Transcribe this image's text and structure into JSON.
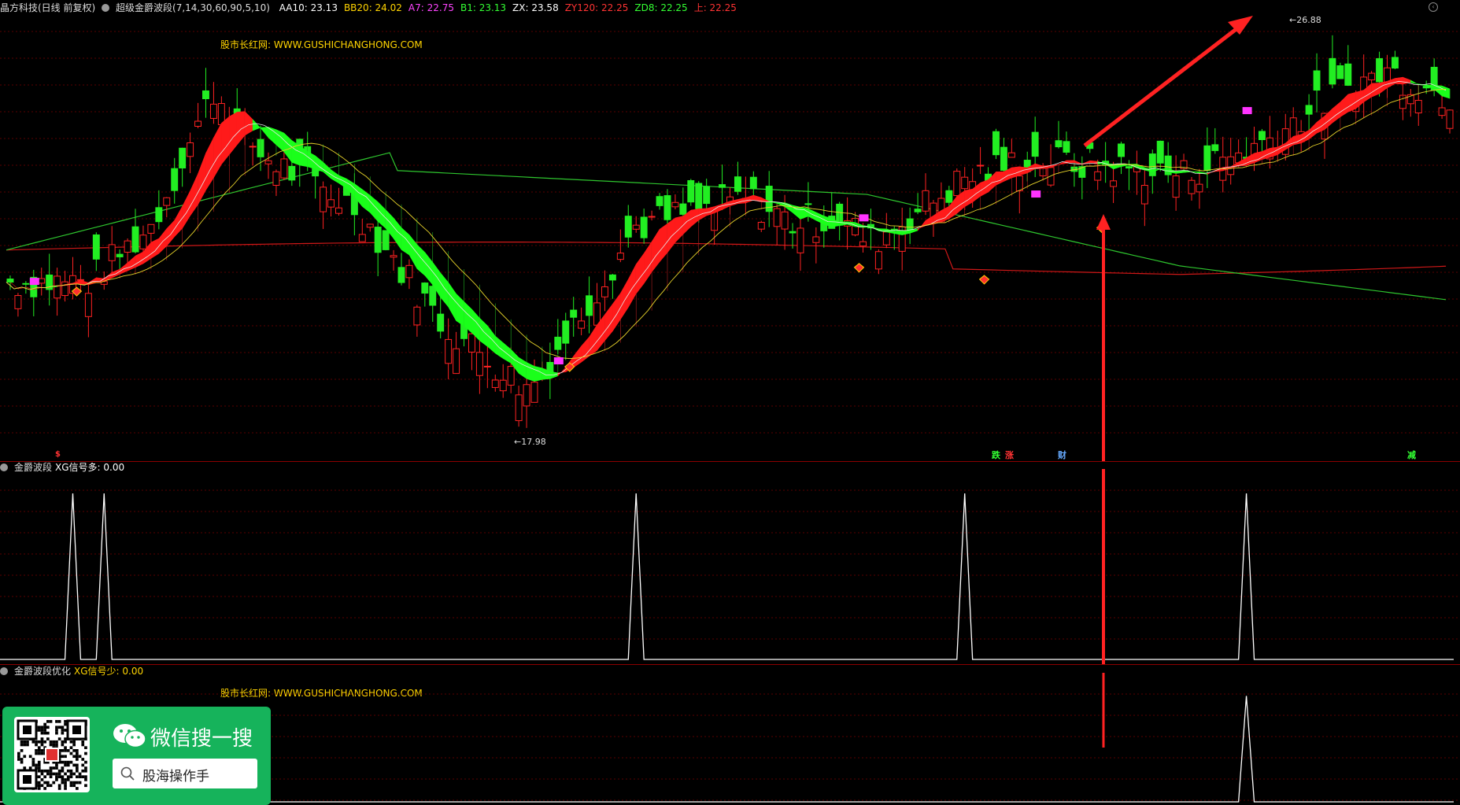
{
  "main_header": {
    "stock": "晶方科技(日线 前复权)",
    "indicator": "超级金爵波段(7,14,30,60,90,5,10)",
    "values": [
      {
        "text": "AA10: 23.13",
        "color": "#ffffff"
      },
      {
        "text": "BB20: 24.02",
        "color": "#ffd400"
      },
      {
        "text": "A7: 22.75",
        "color": "#ff44ff"
      },
      {
        "text": "B1: 23.13",
        "color": "#33ff33"
      },
      {
        "text": "ZX: 23.58",
        "color": "#ffffff"
      },
      {
        "text": "ZY120: 22.25",
        "color": "#ff3333"
      },
      {
        "text": "ZD8: 22.25",
        "color": "#33ff33"
      },
      {
        "text": "上: 22.25",
        "color": "#ff3333"
      }
    ]
  },
  "site_text": "股市长红网: WWW.GUSHICHANGHONG.COM",
  "price_labels": {
    "high": "26.88",
    "low": "17.98"
  },
  "event_tags": [
    {
      "text": "跌",
      "color": "#33ff33"
    },
    {
      "text": "涨",
      "color": "#ff3333"
    },
    {
      "text": "财",
      "color": "#66aaff"
    },
    {
      "text": "减",
      "color": "#33ff33"
    },
    {
      "text": "$",
      "color": "#ff3333"
    }
  ],
  "sub1_header": {
    "name": "金爵波段",
    "label": "XG信号多: 0.00"
  },
  "sub2_header": {
    "name": "金爵波段优化",
    "label": "XG信号少: 0.00"
  },
  "promo": {
    "title": "微信搜一搜",
    "search": "股海操作手"
  },
  "colors": {
    "up": "#ff2222",
    "down": "#22ee22",
    "ma_red": "#d01818",
    "ma_green": "#2ec52e",
    "grid": "#5a0000",
    "signal": "#ffffff"
  },
  "chart_data": [
    {
      "type": "candlestick",
      "title": "",
      "price_extremes": {
        "high": 26.88,
        "low": 17.98
      },
      "ylim": [
        17.0,
        27.5
      ]
    },
    {
      "type": "line",
      "name": "XG信号多",
      "signal_indices": [
        8,
        12,
        80,
        122,
        158
      ],
      "peak_value": 1,
      "ylim": [
        0,
        1.1
      ]
    },
    {
      "type": "line",
      "name": "XG信号少",
      "signal_indices": [
        158
      ],
      "peak_value": 1,
      "ylim": [
        0,
        1.1
      ]
    }
  ]
}
